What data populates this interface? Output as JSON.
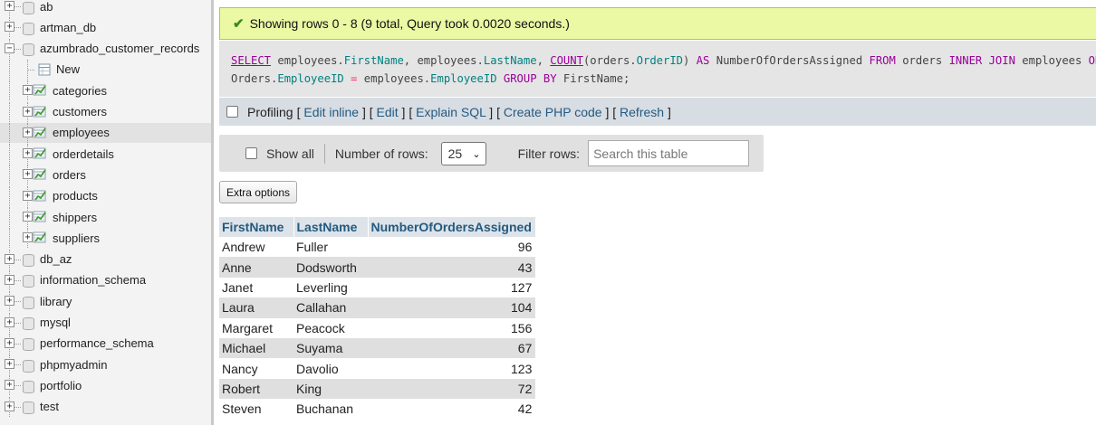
{
  "sidebar": {
    "items": [
      {
        "label": "ab",
        "level": 0,
        "kind": "db",
        "expanded": false
      },
      {
        "label": "artman_db",
        "level": 0,
        "kind": "db",
        "expanded": false
      },
      {
        "label": "azumbrado_customer_records",
        "level": 0,
        "kind": "db",
        "expanded": true
      },
      {
        "label": "New",
        "level": 1,
        "kind": "new"
      },
      {
        "label": "categories",
        "level": 1,
        "kind": "table"
      },
      {
        "label": "customers",
        "level": 1,
        "kind": "table"
      },
      {
        "label": "employees",
        "level": 1,
        "kind": "table",
        "selected": true
      },
      {
        "label": "orderdetails",
        "level": 1,
        "kind": "table"
      },
      {
        "label": "orders",
        "level": 1,
        "kind": "table"
      },
      {
        "label": "products",
        "level": 1,
        "kind": "table"
      },
      {
        "label": "shippers",
        "level": 1,
        "kind": "table"
      },
      {
        "label": "suppliers",
        "level": 1,
        "kind": "table"
      },
      {
        "label": "db_az",
        "level": 0,
        "kind": "db",
        "expanded": false
      },
      {
        "label": "information_schema",
        "level": 0,
        "kind": "db",
        "expanded": false
      },
      {
        "label": "library",
        "level": 0,
        "kind": "db",
        "expanded": false
      },
      {
        "label": "mysql",
        "level": 0,
        "kind": "db",
        "expanded": false
      },
      {
        "label": "performance_schema",
        "level": 0,
        "kind": "db",
        "expanded": false
      },
      {
        "label": "phpmyadmin",
        "level": 0,
        "kind": "db",
        "expanded": false
      },
      {
        "label": "portfolio",
        "level": 0,
        "kind": "db",
        "expanded": false
      },
      {
        "label": "test",
        "level": 0,
        "kind": "db",
        "expanded": false
      }
    ]
  },
  "status": {
    "message": "Showing rows 0 - 8 (9 total, Query took 0.0020 seconds.)"
  },
  "sql": {
    "tokens": [
      {
        "t": "SELECT",
        "c": "kw-u"
      },
      {
        "t": " employees.",
        "c": ""
      },
      {
        "t": "FirstName",
        "c": "col"
      },
      {
        "t": ", employees.",
        "c": ""
      },
      {
        "t": "LastName",
        "c": "col"
      },
      {
        "t": ", ",
        "c": ""
      },
      {
        "t": "COUNT",
        "c": "fn"
      },
      {
        "t": "(orders.",
        "c": ""
      },
      {
        "t": "OrderID",
        "c": "col"
      },
      {
        "t": ") ",
        "c": ""
      },
      {
        "t": "AS",
        "c": "kw"
      },
      {
        "t": " NumberOfOrdersAssigned ",
        "c": ""
      },
      {
        "t": "FROM",
        "c": "kw"
      },
      {
        "t": " orders ",
        "c": ""
      },
      {
        "t": "INNER",
        "c": "kw"
      },
      {
        "t": " ",
        "c": ""
      },
      {
        "t": "JOIN",
        "c": "kw"
      },
      {
        "t": " employees ",
        "c": ""
      },
      {
        "t": "ON",
        "c": "kw"
      },
      {
        "t": "\n",
        "c": ""
      },
      {
        "t": "Orders.",
        "c": ""
      },
      {
        "t": "EmployeeID",
        "c": "col"
      },
      {
        "t": " ",
        "c": ""
      },
      {
        "t": "=",
        "c": "op"
      },
      {
        "t": " employees.",
        "c": ""
      },
      {
        "t": "EmployeeID",
        "c": "col"
      },
      {
        "t": " ",
        "c": ""
      },
      {
        "t": "GROUP BY",
        "c": "kw"
      },
      {
        "t": " FirstName;",
        "c": ""
      }
    ]
  },
  "profiling": {
    "label": "Profiling",
    "links": [
      "Edit inline",
      "Edit",
      "Explain SQL",
      "Create PHP code",
      "Refresh"
    ]
  },
  "nav": {
    "show_all": "Show all",
    "rows_label": "Number of rows:",
    "rows_value": "25",
    "filter_label": "Filter rows:",
    "filter_placeholder": "Search this table"
  },
  "extra_options": "Extra options",
  "results": {
    "columns": [
      "FirstName",
      "LastName",
      "NumberOfOrdersAssigned"
    ],
    "rows": [
      [
        "Andrew",
        "Fuller",
        "96"
      ],
      [
        "Anne",
        "Dodsworth",
        "43"
      ],
      [
        "Janet",
        "Leverling",
        "127"
      ],
      [
        "Laura",
        "Callahan",
        "104"
      ],
      [
        "Margaret",
        "Peacock",
        "156"
      ],
      [
        "Michael",
        "Suyama",
        "67"
      ],
      [
        "Nancy",
        "Davolio",
        "123"
      ],
      [
        "Robert",
        "King",
        "72"
      ],
      [
        "Steven",
        "Buchanan",
        "42"
      ]
    ]
  }
}
